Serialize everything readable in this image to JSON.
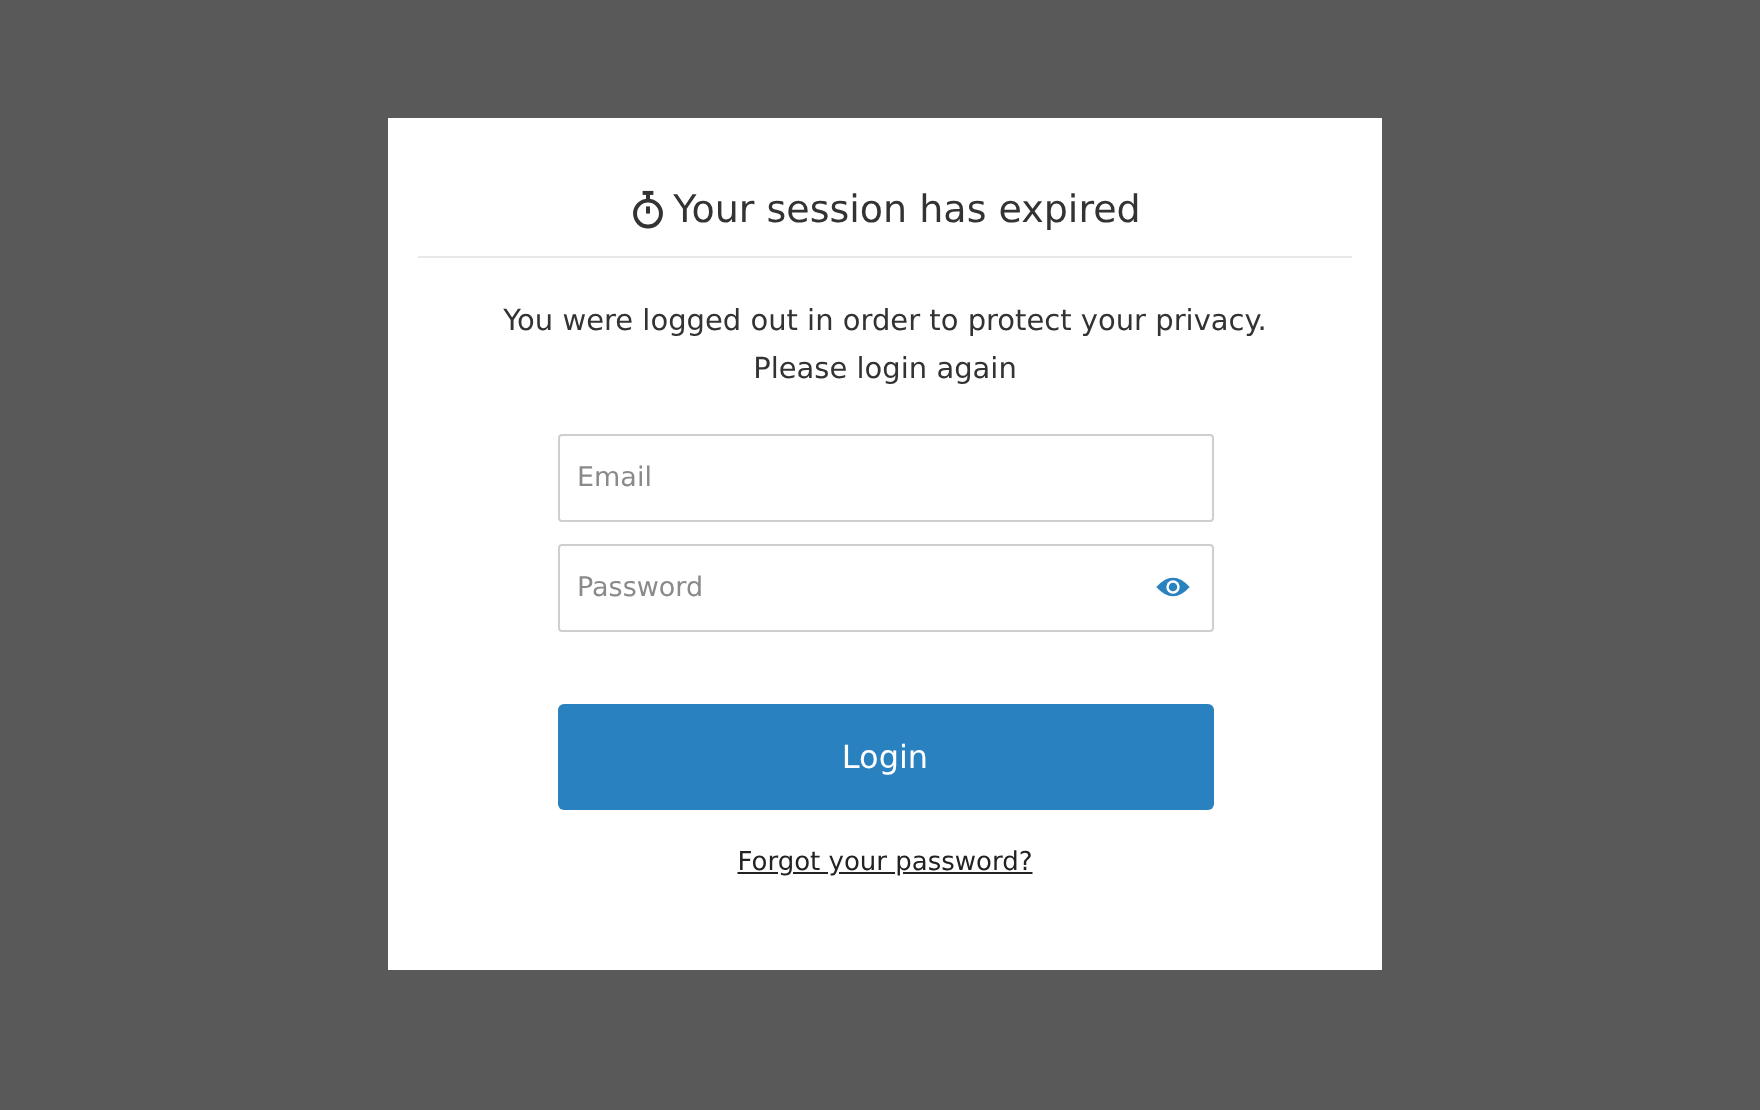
{
  "dialog": {
    "title": "Your session has expired",
    "message": [
      "You were logged out in order to protect your privacy.",
      "Please login again"
    ],
    "fields": [
      {
        "kind": "text",
        "placeholder": "Email"
      },
      {
        "kind": "password",
        "placeholder": "Password"
      }
    ],
    "button": "Login",
    "link": "Forgot your password?"
  }
}
